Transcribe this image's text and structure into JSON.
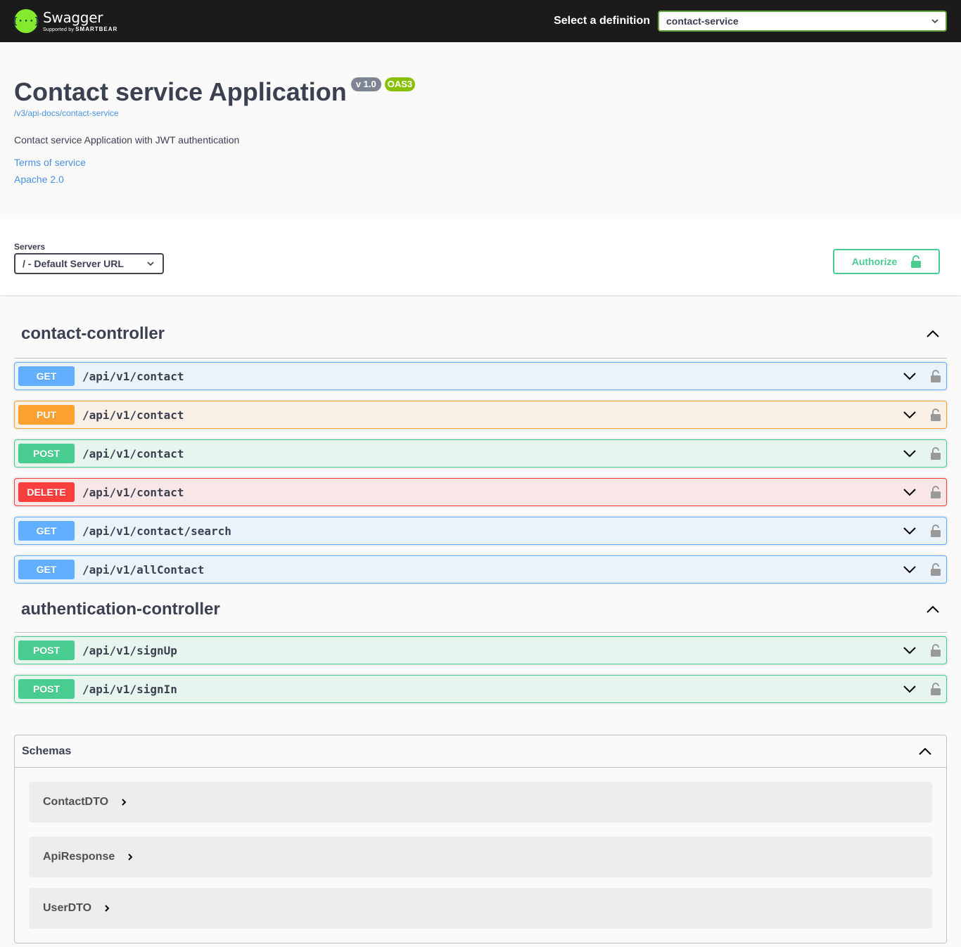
{
  "topbar": {
    "logo_text": "Swagger",
    "logo_sub_prefix": "Supported by",
    "logo_sub_brand": "SMARTBEAR",
    "definition_label": "Select a definition",
    "definition_value": "contact-service"
  },
  "info": {
    "title": "Contact service Application",
    "version": "v 1.0",
    "oas": "OAS3",
    "url": "/v3/api-docs/contact-service",
    "description": "Contact service Application with JWT authentication",
    "terms": "Terms of service",
    "license": "Apache 2.0"
  },
  "servers": {
    "label": "Servers",
    "selected": "/ - Default Server URL",
    "authorize_label": "Authorize"
  },
  "tags": [
    {
      "name": "contact-controller",
      "operations": [
        {
          "method": "GET",
          "path": "/api/v1/contact"
        },
        {
          "method": "PUT",
          "path": "/api/v1/contact"
        },
        {
          "method": "POST",
          "path": "/api/v1/contact"
        },
        {
          "method": "DELETE",
          "path": "/api/v1/contact"
        },
        {
          "method": "GET",
          "path": "/api/v1/contact/search"
        },
        {
          "method": "GET",
          "path": "/api/v1/allContact"
        }
      ]
    },
    {
      "name": "authentication-controller",
      "operations": [
        {
          "method": "POST",
          "path": "/api/v1/signUp"
        },
        {
          "method": "POST",
          "path": "/api/v1/signIn"
        }
      ]
    }
  ],
  "schemas": {
    "title": "Schemas",
    "items": [
      "ContactDTO",
      "ApiResponse",
      "UserDTO"
    ]
  },
  "colors": {
    "get": "#61affe",
    "put": "#fca130",
    "post": "#49cc90",
    "delete": "#f93e3e",
    "logo": "#85ea2d"
  }
}
